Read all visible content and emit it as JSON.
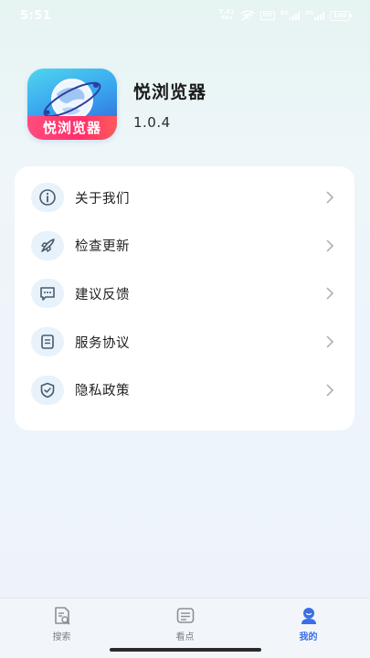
{
  "status_bar": {
    "time": "5:51",
    "net_speed": "7.41",
    "net_speed_unit": "KB/s",
    "hd_badge": "HD",
    "gen_label": "5G",
    "gen2_label": "5G",
    "battery": "100"
  },
  "app": {
    "name": "悦浏览器",
    "version": "1.0.4",
    "logo_text": "悦浏览器"
  },
  "menu": {
    "items": [
      {
        "label": "关于我们",
        "icon": "info-icon"
      },
      {
        "label": "检查更新",
        "icon": "rocket-icon"
      },
      {
        "label": "建议反馈",
        "icon": "chat-icon"
      },
      {
        "label": "服务协议",
        "icon": "document-icon"
      },
      {
        "label": "隐私政策",
        "icon": "shield-icon"
      }
    ]
  },
  "bottom_nav": {
    "items": [
      {
        "label": "搜索",
        "icon": "search-doc-icon",
        "active": false
      },
      {
        "label": "看点",
        "icon": "news-icon",
        "active": false
      },
      {
        "label": "我的",
        "icon": "profile-icon",
        "active": true
      }
    ]
  },
  "colors": {
    "accent": "#3b6ee6",
    "icon_stroke": "#4a5a6a",
    "icon_bg": "#e8f2fa",
    "nav_inactive": "#7a7f86"
  }
}
